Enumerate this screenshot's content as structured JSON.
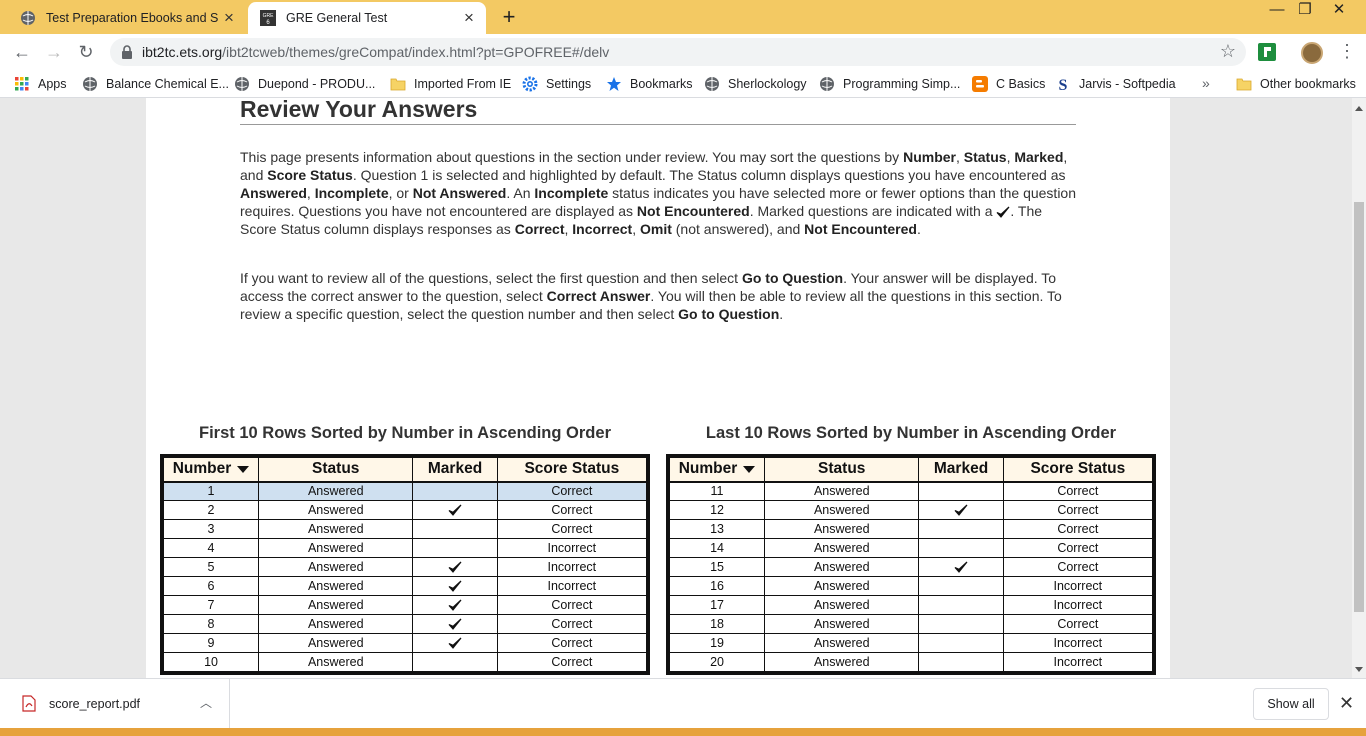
{
  "tabs": [
    {
      "title": "Test Preparation Ebooks and Ser"
    },
    {
      "title": "GRE General Test",
      "favicon_text": "GRE 6"
    }
  ],
  "window": {
    "minimize": "—",
    "restore": "❐",
    "close": "✕"
  },
  "toolbar": {
    "url_host": "ibt2tc.ets.org",
    "url_path": "/ibt2tcweb/themes/greCompat/index.html?pt=GPOFREE#/delv"
  },
  "bookmarks": [
    {
      "label": "Apps",
      "icon": "apps-grid-icon"
    },
    {
      "label": "Balance Chemical E...",
      "icon": "globe-icon"
    },
    {
      "label": "Duepond - PRODU...",
      "icon": "globe-icon"
    },
    {
      "label": "Imported From IE",
      "icon": "folder-icon"
    },
    {
      "label": "Settings",
      "icon": "gear-icon"
    },
    {
      "label": "Bookmarks",
      "icon": "star-icon"
    },
    {
      "label": "Sherlockology",
      "icon": "globe-icon"
    },
    {
      "label": "Programming Simp...",
      "icon": "globe-icon"
    },
    {
      "label": "C Basics",
      "icon": "blogger-icon"
    },
    {
      "label": "Jarvis - Softpedia",
      "icon": "softpedia-icon"
    },
    {
      "label": "Other bookmarks",
      "icon": "folder-icon"
    }
  ],
  "page": {
    "heading": "Review Your Answers",
    "para1": [
      {
        "t": "This page presents information about questions in the section under review. You may sort the questions by "
      },
      {
        "t": "Number",
        "b": true
      },
      {
        "t": ", "
      },
      {
        "t": "Status",
        "b": true
      },
      {
        "t": ", "
      },
      {
        "t": "Marked",
        "b": true
      },
      {
        "t": ", and "
      },
      {
        "t": "Score Status",
        "b": true
      },
      {
        "t": ". Question 1 is selected and highlighted by default. The Status column displays questions you have encountered as "
      },
      {
        "t": "Answered",
        "b": true
      },
      {
        "t": ", "
      },
      {
        "t": "Incomplete",
        "b": true
      },
      {
        "t": ", or "
      },
      {
        "t": "Not Answered",
        "b": true
      },
      {
        "t": ". An "
      },
      {
        "t": "Incomplete",
        "b": true
      },
      {
        "t": " status indicates you have selected more or fewer options than the question requires. Questions you have not encountered are displayed as "
      },
      {
        "t": "Not Encountered",
        "b": true
      },
      {
        "t": ". Marked questions are indicated with a "
      },
      {
        "check": true
      },
      {
        "t": ". The Score Status column displays responses as "
      },
      {
        "t": "Correct",
        "b": true
      },
      {
        "t": ", "
      },
      {
        "t": "Incorrect",
        "b": true
      },
      {
        "t": ", "
      },
      {
        "t": "Omit",
        "b": true
      },
      {
        "t": " (not answered), and "
      },
      {
        "t": "Not Encountered",
        "b": true
      },
      {
        "t": "."
      }
    ],
    "para2": [
      {
        "t": "If you want to review all of the questions, select the first question and then select "
      },
      {
        "t": "Go to Question",
        "b": true
      },
      {
        "t": ". Your answer will be displayed. To access the correct answer to the question, select "
      },
      {
        "t": "Correct Answer",
        "b": true
      },
      {
        "t": ". You will then be able to review all the questions in this section. To review a specific question, select the question number and then select "
      },
      {
        "t": "Go to Question",
        "b": true
      },
      {
        "t": "."
      }
    ],
    "columns": [
      "Number",
      "Status",
      "Marked",
      "Score Status"
    ],
    "tables": [
      {
        "title": "First 10 Rows Sorted by Number in Ascending Order",
        "rows": [
          {
            "number": "1",
            "status": "Answered",
            "marked": false,
            "score": "Correct",
            "selected": true
          },
          {
            "number": "2",
            "status": "Answered",
            "marked": true,
            "score": "Correct"
          },
          {
            "number": "3",
            "status": "Answered",
            "marked": false,
            "score": "Correct"
          },
          {
            "number": "4",
            "status": "Answered",
            "marked": false,
            "score": "Incorrect"
          },
          {
            "number": "5",
            "status": "Answered",
            "marked": true,
            "score": "Incorrect"
          },
          {
            "number": "6",
            "status": "Answered",
            "marked": true,
            "score": "Incorrect"
          },
          {
            "number": "7",
            "status": "Answered",
            "marked": true,
            "score": "Correct"
          },
          {
            "number": "8",
            "status": "Answered",
            "marked": true,
            "score": "Correct"
          },
          {
            "number": "9",
            "status": "Answered",
            "marked": true,
            "score": "Correct"
          },
          {
            "number": "10",
            "status": "Answered",
            "marked": false,
            "score": "Correct"
          }
        ]
      },
      {
        "title": "Last 10 Rows Sorted by Number in Ascending Order",
        "rows": [
          {
            "number": "11",
            "status": "Answered",
            "marked": false,
            "score": "Correct"
          },
          {
            "number": "12",
            "status": "Answered",
            "marked": true,
            "score": "Correct"
          },
          {
            "number": "13",
            "status": "Answered",
            "marked": false,
            "score": "Correct"
          },
          {
            "number": "14",
            "status": "Answered",
            "marked": false,
            "score": "Correct"
          },
          {
            "number": "15",
            "status": "Answered",
            "marked": true,
            "score": "Correct"
          },
          {
            "number": "16",
            "status": "Answered",
            "marked": false,
            "score": "Incorrect"
          },
          {
            "number": "17",
            "status": "Answered",
            "marked": false,
            "score": "Incorrect"
          },
          {
            "number": "18",
            "status": "Answered",
            "marked": false,
            "score": "Correct"
          },
          {
            "number": "19",
            "status": "Answered",
            "marked": false,
            "score": "Incorrect"
          },
          {
            "number": "20",
            "status": "Answered",
            "marked": false,
            "score": "Incorrect"
          }
        ]
      }
    ]
  },
  "downloads": {
    "file": "score_report.pdf",
    "show_all": "Show all"
  },
  "colors": {
    "tabstrip": "#f3c963",
    "header_row": "#fff7e8",
    "selected_row": "#cfe0f0"
  }
}
